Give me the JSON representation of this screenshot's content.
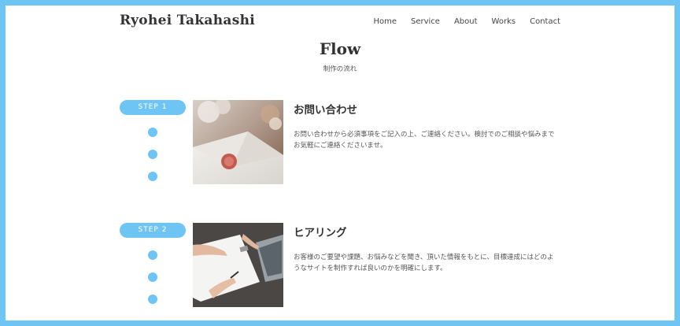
{
  "header": {
    "site_title": "Ryohei Takahashi",
    "nav": [
      "Home",
      "Service",
      "About",
      "Works",
      "Contact"
    ]
  },
  "section": {
    "title": "Flow",
    "subtitle": "制作の流れ"
  },
  "steps": [
    {
      "badge": "STEP 1",
      "title": "お問い合わせ",
      "text": "お問い合わせから必須事項をご記入の上、ご連絡ください。検討でのご相談や悩みまでお気軽にご連絡くださいませ。",
      "image": "envelope-photo"
    },
    {
      "badge": "STEP 2",
      "title": "ヒアリング",
      "text": "お客様のご要望や課題、お悩みなどを聞き、頂いた情報をもとに、目標達成にはどのようなサイトを制作すれば良いのかを明確にします。",
      "image": "hearing-photo"
    }
  ],
  "colors": {
    "accent": "#6ec4f3",
    "frame": "#6ec4f3"
  }
}
